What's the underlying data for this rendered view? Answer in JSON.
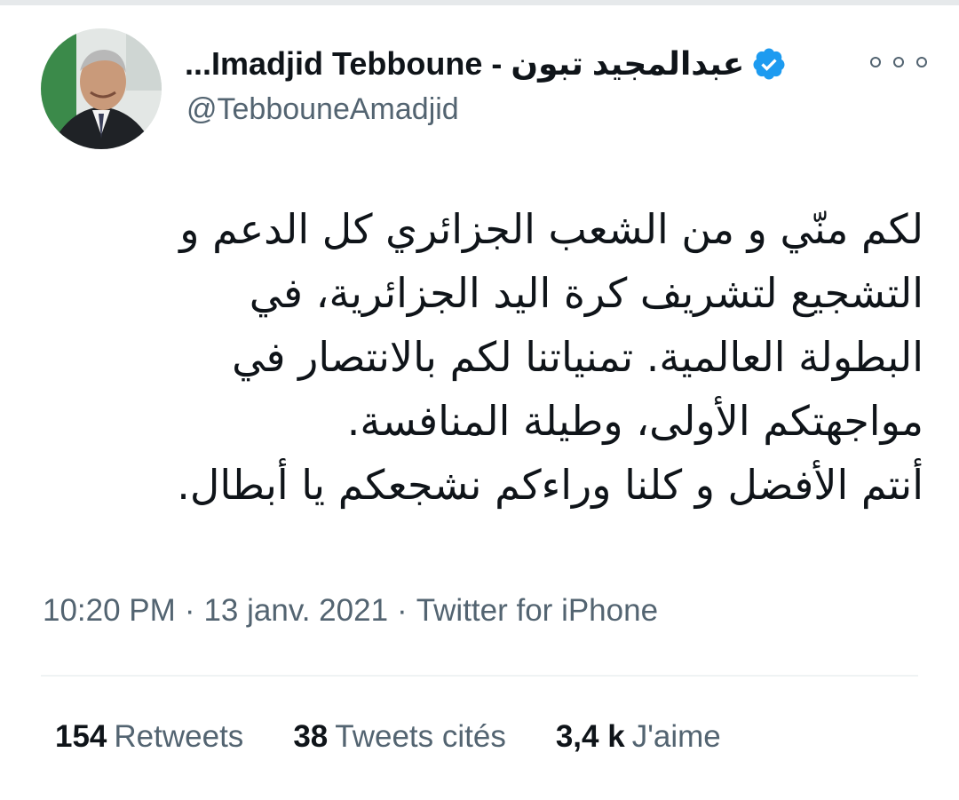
{
  "tweet": {
    "display_name": "عبدالمجيد تبون - Imadjid Tebboune...",
    "handle": "@TebbouneAmadjid",
    "verified_icon": "verified-badge-icon",
    "more_icon": "more-options-icon",
    "text_lines": [
      "لكم منّي و من الشعب الجزائري كل الدعم و",
      "التشجيع لتشريف كرة اليد الجزائرية، في",
      "البطولة العالمية. تمنياتنا لكم بالانتصار في",
      "مواجهتكم الأولى، وطيلة المنافسة.",
      "أنتم الأفضل و كلنا وراءكم نشجعكم يا أبطال."
    ],
    "time": "10:20 PM",
    "date": "13 janv. 2021",
    "source": "Twitter for iPhone",
    "separator": "·"
  },
  "stats": {
    "retweets_count": "154",
    "retweets_label": "Retweets",
    "quotes_count": "38",
    "quotes_label": "Tweets cités",
    "likes_count": "3,4 k",
    "likes_label": "J'aime"
  },
  "colors": {
    "text_primary": "#0f1419",
    "text_secondary": "#536471",
    "verified_blue": "#1d9bf0",
    "divider": "#eff3f4"
  }
}
